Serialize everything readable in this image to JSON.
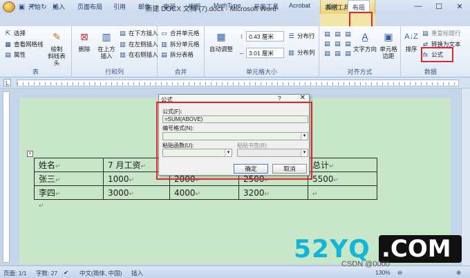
{
  "window": {
    "title": "新建 DOCX 文档 (7).docx - Microsoft Word",
    "context_group": "表格工具",
    "minimize": "—",
    "maximize": "☐",
    "close": "✕"
  },
  "tabs": [
    "开始",
    "插入",
    "页面布局",
    "引用",
    "邮件",
    "审阅",
    "视图",
    "MathType",
    "开发工具",
    "Acrobat",
    "设计",
    "布局"
  ],
  "active_tab": "布局",
  "ribbon": {
    "table_group": {
      "label": "表",
      "select": "选择",
      "gridlines": "查看网格线",
      "properties": "属性"
    },
    "draw_group": {
      "draw": "绘制",
      "eraser": "斜线表头"
    },
    "rows_cols": {
      "label": "行和列",
      "delete": "删除",
      "insert_above": "在上方",
      "insert_above2": "插入",
      "insert_below": "在下方插入",
      "insert_left": "在左侧插入",
      "insert_right": "在右侧插入"
    },
    "merge": {
      "label": "合并",
      "merge_cells": "合并单元格",
      "split_cells": "拆分单元格",
      "split_table": "拆分表格"
    },
    "cell_size": {
      "label": "单元格大小",
      "autofit": "自动调整",
      "height": "0.43 厘米",
      "width": "3.01 厘米",
      "distribute_rows": "分布行",
      "distribute_cols": "分布列"
    },
    "alignment": {
      "label": "对齐方式",
      "text_direction": "文字方向",
      "cell_margins": "单元格",
      "cell_margins2": "边距"
    },
    "data": {
      "label": "数据",
      "sort": "排序",
      "repeat_header": "重复标题行",
      "convert_text": "转换为文本",
      "formula": "公式"
    }
  },
  "dialog": {
    "title": "公式",
    "help": "?",
    "close": "✕",
    "formula_label": "公式(F):",
    "formula_value": "=SUM(ABOVE)",
    "number_format_label": "编号格式(N):",
    "paste_function_label": "粘贴函数(U):",
    "paste_bookmark_label": "粘贴书签(B):",
    "ok": "确定",
    "cancel": "取消"
  },
  "table": {
    "rows": [
      [
        "姓名",
        "7 月工资",
        "",
        "",
        "总计"
      ],
      [
        "张三",
        "1000",
        "2000",
        "2500",
        "5500"
      ],
      [
        "李四",
        "3000",
        "4000",
        "3200",
        ""
      ]
    ]
  },
  "statusbar": {
    "page": "页面: 1/1",
    "words": "字数: 27",
    "language": "中文(简体, 中国)",
    "mode": "插入",
    "zoom": "130%"
  },
  "watermark": {
    "text": "52YQ",
    "text2": ".COM",
    "csdn": "CSDN @0000"
  }
}
